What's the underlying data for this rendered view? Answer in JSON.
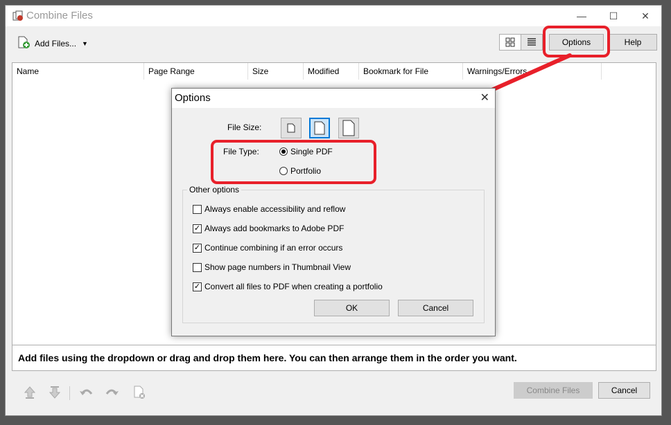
{
  "window": {
    "title": "Combine Files",
    "controls": {
      "minimize": "—",
      "maximize": "☐",
      "close": "✕"
    }
  },
  "toolbar": {
    "add_files_label": "Add Files...",
    "options_label": "Options",
    "help_label": "Help"
  },
  "file_list": {
    "columns": [
      "Name",
      "Page Range",
      "Size",
      "Modified",
      "Bookmark for File",
      "Warnings/Errors"
    ]
  },
  "hint": "Add files using the dropdown or drag and drop them here. You can then arrange them in the order you want.",
  "bottom": {
    "combine_label": "Combine Files",
    "cancel_label": "Cancel"
  },
  "options_dialog": {
    "title": "Options",
    "close": "✕",
    "file_size_label": "File Size:",
    "file_size_selected": "medium",
    "file_type_label": "File Type:",
    "file_type_options": [
      "Single PDF",
      "Portfolio"
    ],
    "file_type_selected": "Single PDF",
    "other_options_label": "Other options",
    "checkboxes": [
      {
        "label": "Always enable accessibility and reflow",
        "checked": false
      },
      {
        "label": "Always add bookmarks to Adobe PDF",
        "checked": true
      },
      {
        "label": "Continue combining if an error occurs",
        "checked": true
      },
      {
        "label": "Show page numbers in Thumbnail View",
        "checked": false
      },
      {
        "label": "Convert all files to PDF when creating a portfolio",
        "checked": true
      }
    ],
    "ok_label": "OK",
    "cancel_label": "Cancel"
  },
  "colors": {
    "highlight": "#e8202a",
    "selection": "#0078d7"
  }
}
